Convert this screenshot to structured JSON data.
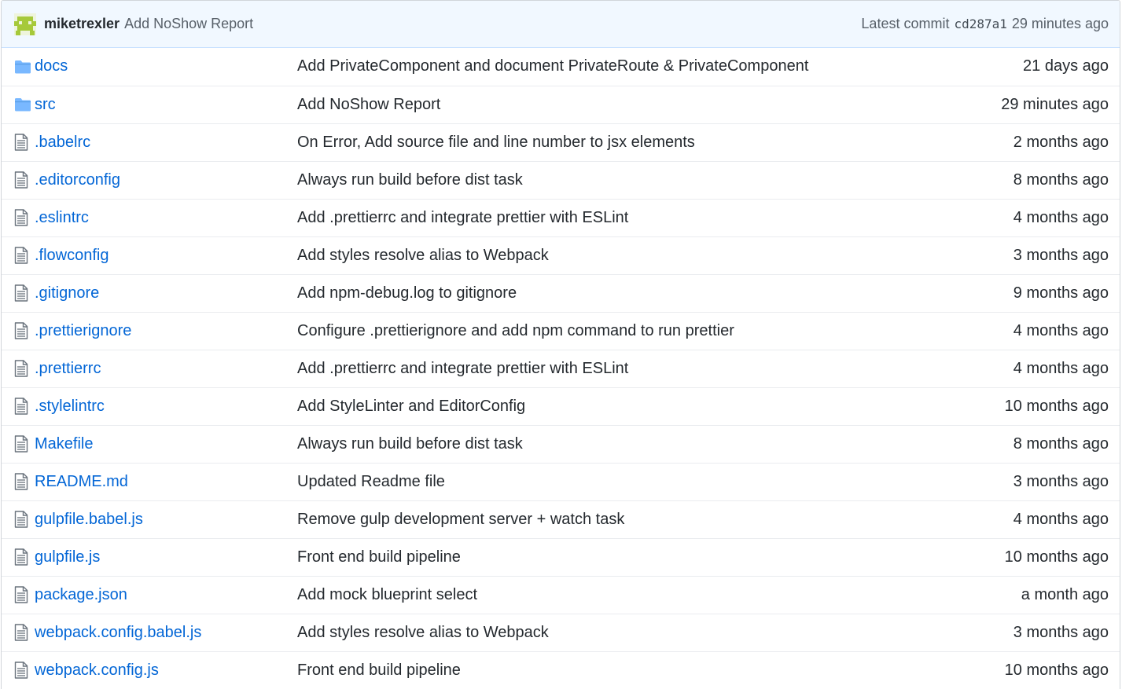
{
  "commit": {
    "author": "miketrexler",
    "message": "Add NoShow Report",
    "latest_label": "Latest commit",
    "sha": "cd287a1",
    "age": "29 minutes ago"
  },
  "colors": {
    "link": "#0366d6",
    "folder_icon": "#79b8ff",
    "file_icon": "#6a737d",
    "commit_bg": "#f1f8ff",
    "avatar_green": "#a6c93a"
  },
  "files": [
    {
      "type": "dir",
      "icon": "folder-icon",
      "name": "docs",
      "message": "Add PrivateComponent and document PrivateRoute & PrivateComponent",
      "age": "21 days ago"
    },
    {
      "type": "dir",
      "icon": "folder-icon",
      "name": "src",
      "message": "Add NoShow Report",
      "age": "29 minutes ago"
    },
    {
      "type": "file",
      "icon": "file-icon",
      "name": ".babelrc",
      "message": "On Error, Add source file and line number to jsx elements",
      "age": "2 months ago"
    },
    {
      "type": "file",
      "icon": "file-icon",
      "name": ".editorconfig",
      "message": "Always run build before dist task",
      "age": "8 months ago"
    },
    {
      "type": "file",
      "icon": "file-icon",
      "name": ".eslintrc",
      "message": "Add .prettierrc and integrate prettier with ESLint",
      "age": "4 months ago"
    },
    {
      "type": "file",
      "icon": "file-icon",
      "name": ".flowconfig",
      "message": "Add styles resolve alias to Webpack",
      "age": "3 months ago"
    },
    {
      "type": "file",
      "icon": "file-icon",
      "name": ".gitignore",
      "message": "Add npm-debug.log to gitignore",
      "age": "9 months ago"
    },
    {
      "type": "file",
      "icon": "file-icon",
      "name": ".prettierignore",
      "message": "Configure .prettierignore and add npm command to run prettier",
      "age": "4 months ago"
    },
    {
      "type": "file",
      "icon": "file-icon",
      "name": ".prettierrc",
      "message": "Add .prettierrc and integrate prettier with ESLint",
      "age": "4 months ago"
    },
    {
      "type": "file",
      "icon": "file-icon",
      "name": ".stylelintrc",
      "message": "Add StyleLinter and EditorConfig",
      "age": "10 months ago"
    },
    {
      "type": "file",
      "icon": "file-icon",
      "name": "Makefile",
      "message": "Always run build before dist task",
      "age": "8 months ago"
    },
    {
      "type": "file",
      "icon": "file-icon",
      "name": "README.md",
      "message": "Updated Readme file",
      "age": "3 months ago"
    },
    {
      "type": "file",
      "icon": "file-icon",
      "name": "gulpfile.babel.js",
      "message": "Remove gulp development server + watch task",
      "age": "4 months ago"
    },
    {
      "type": "file",
      "icon": "file-icon",
      "name": "gulpfile.js",
      "message": "Front end build pipeline",
      "age": "10 months ago"
    },
    {
      "type": "file",
      "icon": "file-icon",
      "name": "package.json",
      "message": "Add mock blueprint select",
      "age": "a month ago"
    },
    {
      "type": "file",
      "icon": "file-icon",
      "name": "webpack.config.babel.js",
      "message": "Add styles resolve alias to Webpack",
      "age": "3 months ago"
    },
    {
      "type": "file",
      "icon": "file-icon",
      "name": "webpack.config.js",
      "message": "Front end build pipeline",
      "age": "10 months ago"
    }
  ]
}
